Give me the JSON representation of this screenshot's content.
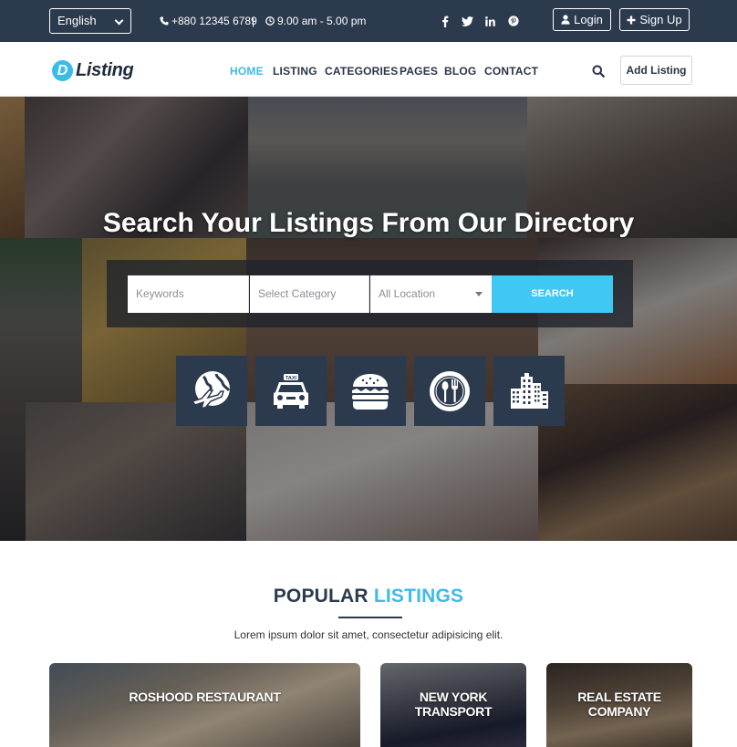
{
  "topbar": {
    "language": "English",
    "phone": "+880 12345 6789",
    "separator": "|",
    "hours": "9.00 am - 5.00 pm",
    "social_icons": [
      "facebook-icon",
      "twitter-icon",
      "linkedin-icon",
      "pinterest-icon"
    ],
    "login_label": "Login",
    "signup_label": "Sign Up"
  },
  "navbar": {
    "logo_letter": "D",
    "logo_text": "Listing",
    "items": [
      {
        "label": "HOME",
        "active": true
      },
      {
        "label": "LISTING",
        "active": false
      },
      {
        "label": "CATEGORIES",
        "active": false
      },
      {
        "label": "PAGES",
        "active": false
      },
      {
        "label": "BLOG",
        "active": false
      },
      {
        "label": "CONTACT",
        "active": false
      }
    ],
    "search_icon": "search-icon",
    "add_listing_label": "Add Listing"
  },
  "hero": {
    "title": "Search Your Listings From Our Directory",
    "search": {
      "keywords_placeholder": "Keywords",
      "category_value": "Select Category",
      "location_value": "All Location",
      "button_label": "SEARCH"
    },
    "category_icons": [
      "globe-plane-icon",
      "taxi-icon",
      "burger-icon",
      "plate-cutlery-icon",
      "buildings-icon"
    ]
  },
  "popular": {
    "title_main": "POPULAR",
    "title_accent": "LISTINGS",
    "subtitle": "Lorem ipsum dolor sit amet, consectetur adipisicing elit.",
    "cards": [
      {
        "title": "ROSHOOD RESTAURANT"
      },
      {
        "title": "NEW YORK TRANSPORT"
      },
      {
        "title": "REAL ESTATE COMPANY"
      }
    ]
  },
  "colors": {
    "dark_navy": "#2c3a4e",
    "accent_blue": "#3dbbe8",
    "search_button": "#3fc8f4"
  }
}
